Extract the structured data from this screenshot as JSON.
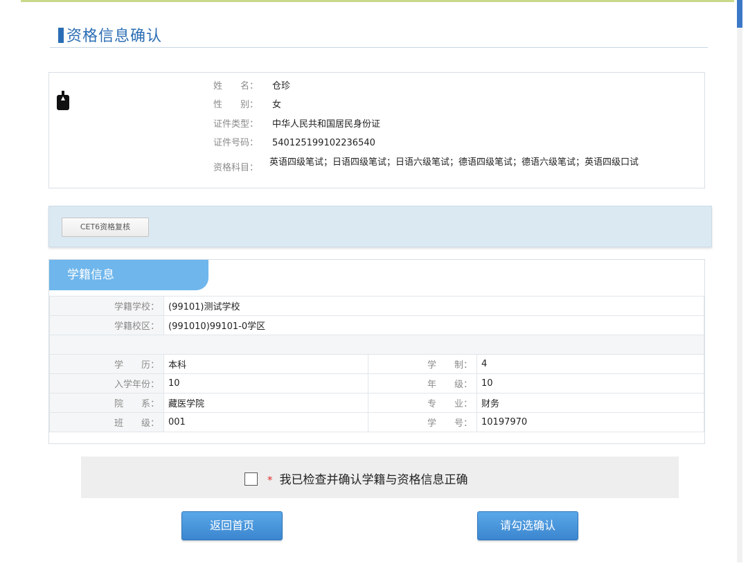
{
  "page": {
    "title": "资格信息确认",
    "colors": {
      "accent": "#2a6db4",
      "tab": "#6fb6ec",
      "button": "#4a98dc",
      "required": "#e03030"
    }
  },
  "personal": {
    "avatar_icon": "person-silhouette-icon",
    "fields": [
      {
        "label": "姓　　名：",
        "value": "仓珍"
      },
      {
        "label": "性　　别：",
        "value": "女"
      },
      {
        "label": "证件类型：",
        "value": "中华人民共和国居民身份证"
      },
      {
        "label": "证件号码：",
        "value": "540125199102236540"
      },
      {
        "label": "资格科目：",
        "value": "英语四级笔试；日语四级笔试；日语六级笔试；德语四级笔试；德语六级笔试；英语四级口试"
      }
    ]
  },
  "review": {
    "button_label": "CET6资格复核"
  },
  "school": {
    "tab_title": "学籍信息",
    "school_name": {
      "label": "学籍学校：",
      "value": "(99101)测试学校"
    },
    "campus": {
      "label": "学籍校区：",
      "value": "(991010)99101-0学区"
    },
    "rows": [
      {
        "l1": "学　　历：",
        "v1": "本科",
        "l2": "学　　制：",
        "v2": "4"
      },
      {
        "l1": "入学年份：",
        "v1": "10",
        "l2": "年　　级：",
        "v2": "10"
      },
      {
        "l1": "院　　系：",
        "v1": "藏医学院",
        "l2": "专　　业：",
        "v2": "财务"
      },
      {
        "l1": "班　　级：",
        "v1": "001",
        "l2": "学　　号：",
        "v2": "10197970"
      }
    ]
  },
  "confirm": {
    "required_mark": "*",
    "text": "我已检查并确认学籍与资格信息正确",
    "checked": false
  },
  "buttons": {
    "home": "返回首页",
    "confirm": "请勾选确认"
  }
}
